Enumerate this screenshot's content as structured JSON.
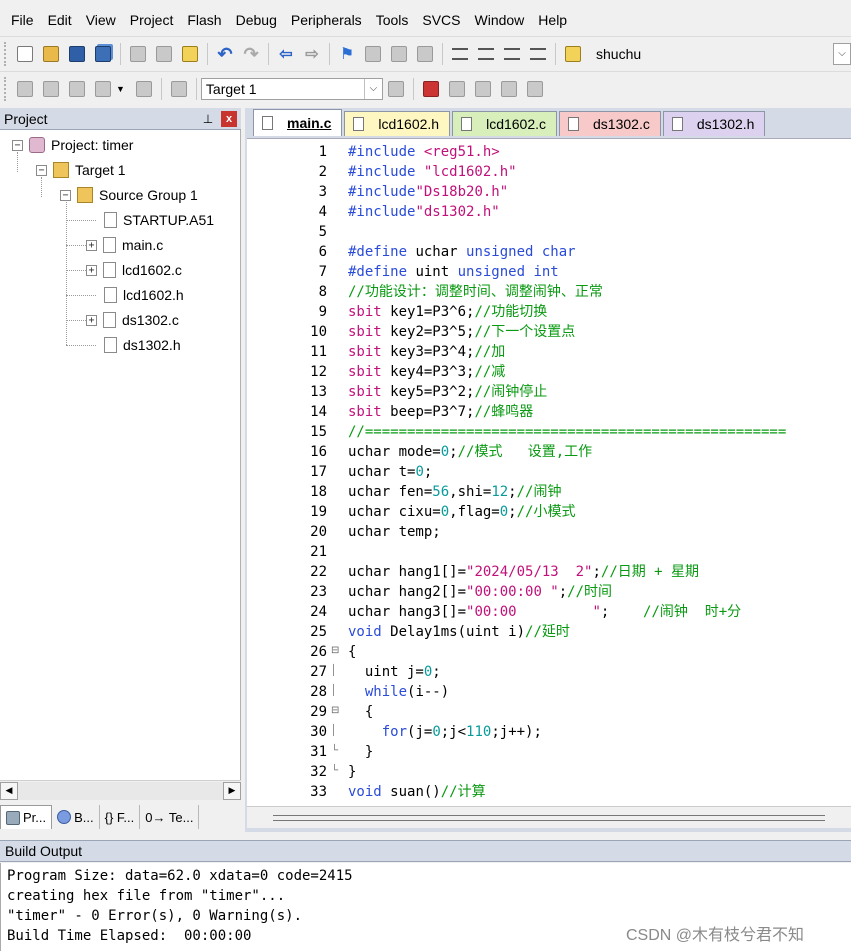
{
  "menubar": {
    "items": [
      "File",
      "Edit",
      "View",
      "Project",
      "Flash",
      "Debug",
      "Peripherals",
      "Tools",
      "SVCS",
      "Window",
      "Help"
    ]
  },
  "toolbar1": {
    "find_value": "shuchu"
  },
  "toolbar2": {
    "target_value": "Target 1"
  },
  "project_panel": {
    "title": "Project",
    "pin_icon": "pin-icon",
    "close_label": "x",
    "tree": {
      "project": "Project: timer",
      "target": "Target 1",
      "group": "Source Group 1",
      "files": [
        "STARTUP.A51",
        "main.c",
        "lcd1602.c",
        "lcd1602.h",
        "ds1302.c",
        "ds1302.h"
      ]
    },
    "tabs": [
      "Pr...",
      "B...",
      "{} F...",
      "0→ Te..."
    ]
  },
  "editor": {
    "tabs": [
      {
        "label": "main.c",
        "color": "#ffffff"
      },
      {
        "label": "lcd1602.h",
        "color": "#fff7c2"
      },
      {
        "label": "lcd1602.c",
        "color": "#d8eebb"
      },
      {
        "label": "ds1302.c",
        "color": "#f7c9c9"
      },
      {
        "label": "ds1302.h",
        "color": "#dcd2ef"
      }
    ],
    "line_numbers": [
      "1",
      "2",
      "3",
      "4",
      "5",
      "6",
      "7",
      "8",
      "9",
      "10",
      "11",
      "12",
      "13",
      "14",
      "15",
      "16",
      "17",
      "18",
      "19",
      "20",
      "21",
      "22",
      "23",
      "24",
      "25",
      "26",
      "27",
      "28",
      "29",
      "30",
      "31",
      "32",
      "33"
    ],
    "lines": [
      [
        {
          "t": "#include ",
          "c": "pp"
        },
        {
          "t": "<reg51.h>",
          "c": "str"
        }
      ],
      [
        {
          "t": "#include ",
          "c": "pp"
        },
        {
          "t": "\"lcd1602.h\"",
          "c": "str"
        }
      ],
      [
        {
          "t": "#include",
          "c": "pp"
        },
        {
          "t": "\"Ds18b20.h\"",
          "c": "str"
        }
      ],
      [
        {
          "t": "#include",
          "c": "pp"
        },
        {
          "t": "\"ds1302.h\"",
          "c": "str"
        }
      ],
      [],
      [
        {
          "t": "#define ",
          "c": "pp"
        },
        {
          "t": "uchar ",
          "c": "def"
        },
        {
          "t": "unsigned char",
          "c": "kw"
        }
      ],
      [
        {
          "t": "#define ",
          "c": "pp"
        },
        {
          "t": "uint ",
          "c": "def"
        },
        {
          "t": "unsigned int",
          "c": "kw"
        }
      ],
      [
        {
          "t": "//功能设计：调整时间、调整闹钟、正常",
          "c": "cmt"
        }
      ],
      [
        {
          "t": "sbit ",
          "c": "str"
        },
        {
          "t": "key1=P3^6;",
          "c": "def"
        },
        {
          "t": "//功能切换",
          "c": "cmt"
        }
      ],
      [
        {
          "t": "sbit ",
          "c": "str"
        },
        {
          "t": "key2=P3^5;",
          "c": "def"
        },
        {
          "t": "//下一个设置点",
          "c": "cmt"
        }
      ],
      [
        {
          "t": "sbit ",
          "c": "str"
        },
        {
          "t": "key3=P3^4;",
          "c": "def"
        },
        {
          "t": "//加",
          "c": "cmt"
        }
      ],
      [
        {
          "t": "sbit ",
          "c": "str"
        },
        {
          "t": "key4=P3^3;",
          "c": "def"
        },
        {
          "t": "//减",
          "c": "cmt"
        }
      ],
      [
        {
          "t": "sbit ",
          "c": "str"
        },
        {
          "t": "key5=P3^2;",
          "c": "def"
        },
        {
          "t": "//闹钟停止",
          "c": "cmt"
        }
      ],
      [
        {
          "t": "sbit ",
          "c": "str"
        },
        {
          "t": "beep=P3^7;",
          "c": "def"
        },
        {
          "t": "//蜂鸣器",
          "c": "cmt"
        }
      ],
      [
        {
          "t": "//==================================================",
          "c": "cmt"
        }
      ],
      [
        {
          "t": "uchar mode=",
          "c": "def"
        },
        {
          "t": "0",
          "c": "num"
        },
        {
          "t": ";",
          "c": "def"
        },
        {
          "t": "//模式   设置,工作",
          "c": "cmt"
        }
      ],
      [
        {
          "t": "uchar t=",
          "c": "def"
        },
        {
          "t": "0",
          "c": "num"
        },
        {
          "t": ";",
          "c": "def"
        }
      ],
      [
        {
          "t": "uchar fen=",
          "c": "def"
        },
        {
          "t": "56",
          "c": "num"
        },
        {
          "t": ",shi=",
          "c": "def"
        },
        {
          "t": "12",
          "c": "num"
        },
        {
          "t": ";",
          "c": "def"
        },
        {
          "t": "//闹钟",
          "c": "cmt"
        }
      ],
      [
        {
          "t": "uchar cixu=",
          "c": "def"
        },
        {
          "t": "0",
          "c": "num"
        },
        {
          "t": ",flag=",
          "c": "def"
        },
        {
          "t": "0",
          "c": "num"
        },
        {
          "t": ";",
          "c": "def"
        },
        {
          "t": "//小模式",
          "c": "cmt"
        }
      ],
      [
        {
          "t": "uchar temp;",
          "c": "def"
        }
      ],
      [],
      [
        {
          "t": "uchar hang1[]=",
          "c": "def"
        },
        {
          "t": "\"2024/05/13  2\"",
          "c": "str"
        },
        {
          "t": ";",
          "c": "def"
        },
        {
          "t": "//日期 + 星期",
          "c": "cmt"
        }
      ],
      [
        {
          "t": "uchar hang2[]=",
          "c": "def"
        },
        {
          "t": "\"00:00:00 \"",
          "c": "str"
        },
        {
          "t": ";",
          "c": "def"
        },
        {
          "t": "//时间",
          "c": "cmt"
        }
      ],
      [
        {
          "t": "uchar hang3[]=",
          "c": "def"
        },
        {
          "t": "\"00:00         \"",
          "c": "str"
        },
        {
          "t": ";    ",
          "c": "def"
        },
        {
          "t": "//闹钟  时+分",
          "c": "cmt"
        }
      ],
      [
        {
          "t": "void ",
          "c": "kw"
        },
        {
          "t": "Delay1ms(uint i)",
          "c": "def"
        },
        {
          "t": "//延时",
          "c": "cmt"
        }
      ],
      [
        {
          "t": "{",
          "c": "def"
        }
      ],
      [
        {
          "t": "  uint j=",
          "c": "def"
        },
        {
          "t": "0",
          "c": "num"
        },
        {
          "t": ";",
          "c": "def"
        }
      ],
      [
        {
          "t": "  ",
          "c": "def"
        },
        {
          "t": "while",
          "c": "kw"
        },
        {
          "t": "(i--)",
          "c": "def"
        }
      ],
      [
        {
          "t": "  {",
          "c": "def"
        }
      ],
      [
        {
          "t": "    ",
          "c": "def"
        },
        {
          "t": "for",
          "c": "kw"
        },
        {
          "t": "(j=",
          "c": "def"
        },
        {
          "t": "0",
          "c": "num"
        },
        {
          "t": ";j<",
          "c": "def"
        },
        {
          "t": "110",
          "c": "num"
        },
        {
          "t": ";j++);",
          "c": "def"
        }
      ],
      [
        {
          "t": "  }",
          "c": "def"
        }
      ],
      [
        {
          "t": "}",
          "c": "def"
        }
      ],
      [
        {
          "t": "void ",
          "c": "kw"
        },
        {
          "t": "suan()",
          "c": "def"
        },
        {
          "t": "//计算",
          "c": "cmt"
        }
      ]
    ]
  },
  "build_output": {
    "title": "Build Output",
    "lines": [
      "Program Size: data=62.0 xdata=0 code=2415",
      "creating hex file from \"timer\"...",
      "\"timer\" - 0 Error(s), 0 Warning(s).",
      "Build Time Elapsed:  00:00:00"
    ]
  },
  "watermark": "CSDN @木有枝兮君不知"
}
